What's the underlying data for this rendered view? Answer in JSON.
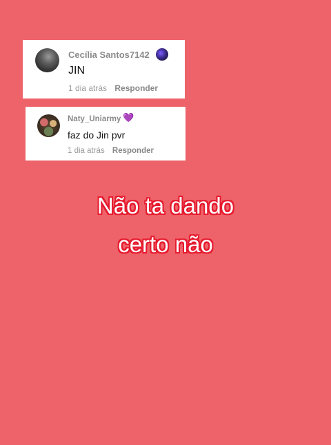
{
  "comments": [
    {
      "username": "Cecília Santos7142",
      "text": "JIN",
      "time": "1 dia atrás",
      "reply_label": "Responder",
      "avatar_icon": "profile-photo",
      "badge_icon": "galaxy-avatar-badge"
    },
    {
      "username": "Naty_Uniarmy",
      "heart": "💜",
      "text": "faz do Jin pvr",
      "time": "1 dia atrás",
      "reply_label": "Responder",
      "avatar_icon": "profile-photo"
    }
  ],
  "overlay": {
    "line1": "Não ta dando",
    "line2": "certo não"
  },
  "colors": {
    "background": "#ee6369",
    "overlay_stroke": "#e61b2f"
  }
}
